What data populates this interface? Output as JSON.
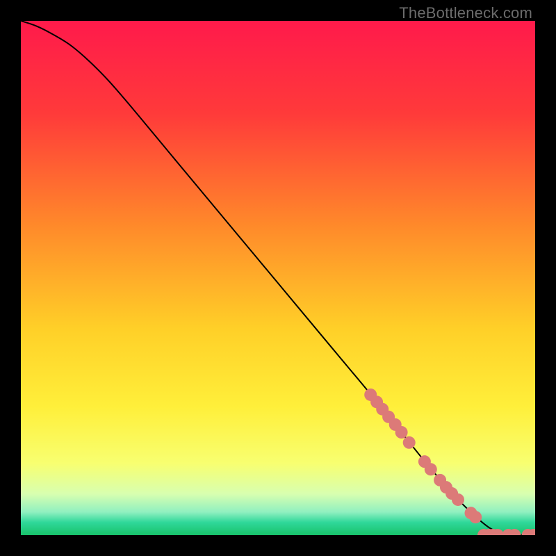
{
  "watermark": "TheBottleneck.com",
  "chart_data": {
    "type": "line",
    "title": "",
    "xlabel": "",
    "ylabel": "",
    "xlim": [
      0,
      100
    ],
    "ylim": [
      0,
      100
    ],
    "grid": false,
    "legend": false,
    "gradient_stops": [
      {
        "offset": 0.0,
        "color": "#ff1a4b"
      },
      {
        "offset": 0.18,
        "color": "#ff3a3a"
      },
      {
        "offset": 0.4,
        "color": "#ff8a2a"
      },
      {
        "offset": 0.6,
        "color": "#ffd028"
      },
      {
        "offset": 0.75,
        "color": "#ffef3a"
      },
      {
        "offset": 0.86,
        "color": "#f8ff70"
      },
      {
        "offset": 0.92,
        "color": "#d8ffb0"
      },
      {
        "offset": 0.955,
        "color": "#90f0c0"
      },
      {
        "offset": 0.975,
        "color": "#30d89a"
      },
      {
        "offset": 1.0,
        "color": "#18c26a"
      }
    ],
    "series": [
      {
        "name": "curve",
        "color": "#000000",
        "stroke_width": 2,
        "x": [
          0,
          3,
          6,
          10,
          15,
          20,
          30,
          40,
          50,
          60,
          70,
          78,
          84,
          88,
          91,
          93,
          95,
          97,
          100
        ],
        "y": [
          100,
          99,
          97.5,
          95,
          90.5,
          85,
          73,
          61,
          49,
          37,
          25,
          15,
          8,
          4,
          1.5,
          0.6,
          0.15,
          0.03,
          0
        ]
      }
    ],
    "markers": {
      "color": "#dc7a78",
      "radius": 9,
      "points": [
        {
          "x": 68.0,
          "y": 27.3
        },
        {
          "x": 69.2,
          "y": 25.9
        },
        {
          "x": 70.3,
          "y": 24.5
        },
        {
          "x": 71.5,
          "y": 23.0
        },
        {
          "x": 72.8,
          "y": 21.5
        },
        {
          "x": 74.0,
          "y": 20.0
        },
        {
          "x": 75.5,
          "y": 18.0
        },
        {
          "x": 78.5,
          "y": 14.3
        },
        {
          "x": 79.7,
          "y": 12.8
        },
        {
          "x": 81.5,
          "y": 10.7
        },
        {
          "x": 82.7,
          "y": 9.3
        },
        {
          "x": 83.8,
          "y": 8.1
        },
        {
          "x": 85.0,
          "y": 6.9
        },
        {
          "x": 87.5,
          "y": 4.3
        },
        {
          "x": 88.4,
          "y": 3.5
        },
        {
          "x": 90.0,
          "y": 0.0
        },
        {
          "x": 91.0,
          "y": 0.0
        },
        {
          "x": 91.8,
          "y": 0.0
        },
        {
          "x": 92.7,
          "y": 0.0
        },
        {
          "x": 94.8,
          "y": 0.0
        },
        {
          "x": 96.0,
          "y": 0.0
        },
        {
          "x": 98.6,
          "y": 0.0
        },
        {
          "x": 99.7,
          "y": 0.0
        }
      ]
    }
  }
}
